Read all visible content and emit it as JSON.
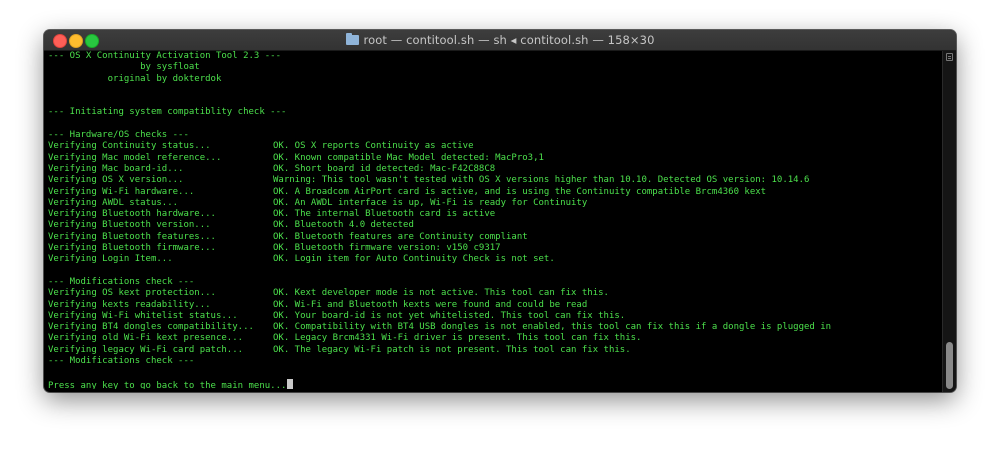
{
  "window": {
    "title": "root — contitool.sh — sh ◂ contitool.sh — 158×30"
  },
  "terminal": {
    "lines": [
      {
        "text": "--- OS X Continuity Activation Tool 2.3 ---"
      },
      {
        "text": "                 by sysfloat"
      },
      {
        "text": "           original by dokterdok"
      },
      {
        "text": ""
      },
      {
        "text": ""
      },
      {
        "text": "--- Initiating system compatiblity check ---"
      },
      {
        "text": ""
      },
      {
        "text": "--- Hardware/OS checks ---"
      },
      {
        "label": "Verifying Continuity status...",
        "result": "OK. OS X reports Continuity as active"
      },
      {
        "label": "Verifying Mac model reference...",
        "result": "OK. Known compatible Mac Model detected: MacPro3,1"
      },
      {
        "label": "Verifying Mac board-id...",
        "result": "OK. Short board id detected: Mac-F42C88C8"
      },
      {
        "label": "Verifying OS X version...",
        "result": "Warning: This tool wasn't tested with OS X versions higher than 10.10. Detected OS version: 10.14.6"
      },
      {
        "label": "Verifying Wi-Fi hardware...",
        "result": "OK. A Broadcom AirPort card is active, and is using the Continuity compatible Brcm4360 kext"
      },
      {
        "label": "Verifying AWDL status...",
        "result": "OK. An AWDL interface is up, Wi-Fi is ready for Continuity"
      },
      {
        "label": "Verifying Bluetooth hardware...",
        "result": "OK. The internal Bluetooth card is active"
      },
      {
        "label": "Verifying Bluetooth version...",
        "result": "OK. Bluetooth 4.0 detected"
      },
      {
        "label": "Verifying Bluetooth features...",
        "result": "OK. Bluetooth features are Continuity compliant"
      },
      {
        "label": "Verifying Bluetooth firmware...",
        "result": "OK. Bluetooth firmware version: v150 c9317"
      },
      {
        "label": "Verifying Login Item...",
        "result": "OK. Login item for Auto Continuity Check is not set."
      },
      {
        "text": ""
      },
      {
        "text": "--- Modifications check ---"
      },
      {
        "label": "Verifying OS kext protection...",
        "result": "OK. Kext developer mode is not active. This tool can fix this."
      },
      {
        "label": "Verifying kexts readability...",
        "result": "OK. Wi-Fi and Bluetooth kexts were found and could be read"
      },
      {
        "label": "Verifying Wi-Fi whitelist status...",
        "result": "OK. Your board-id is not yet whitelisted. This tool can fix this."
      },
      {
        "label": "Verifying BT4 dongles compatibility...",
        "result": "OK. Compatibility with BT4 USB dongles is not enabled, this tool can fix this if a dongle is plugged in"
      },
      {
        "label": "Verifying old Wi-Fi kext presence...",
        "result": "OK. Legacy Brcm4331 Wi-Fi driver is present. This tool can fix this."
      },
      {
        "label": "Verifying legacy Wi-Fi card patch...",
        "result": "OK. The legacy Wi-Fi patch is not present. This tool can fix this."
      },
      {
        "text": "--- Modifications check ---"
      },
      {
        "text": ""
      },
      {
        "text": "Press any key to go back to the main menu...",
        "cursor": true
      }
    ]
  },
  "icons": {
    "folder": "folder-icon",
    "close": "close-icon",
    "minimize": "minimize-icon",
    "zoom": "zoom-icon"
  },
  "colors": {
    "terminal_text": "#4ce04c",
    "terminal_bg": "#000000",
    "close": "#fe5f57",
    "minimize": "#febc2e",
    "zoom": "#28c840"
  }
}
